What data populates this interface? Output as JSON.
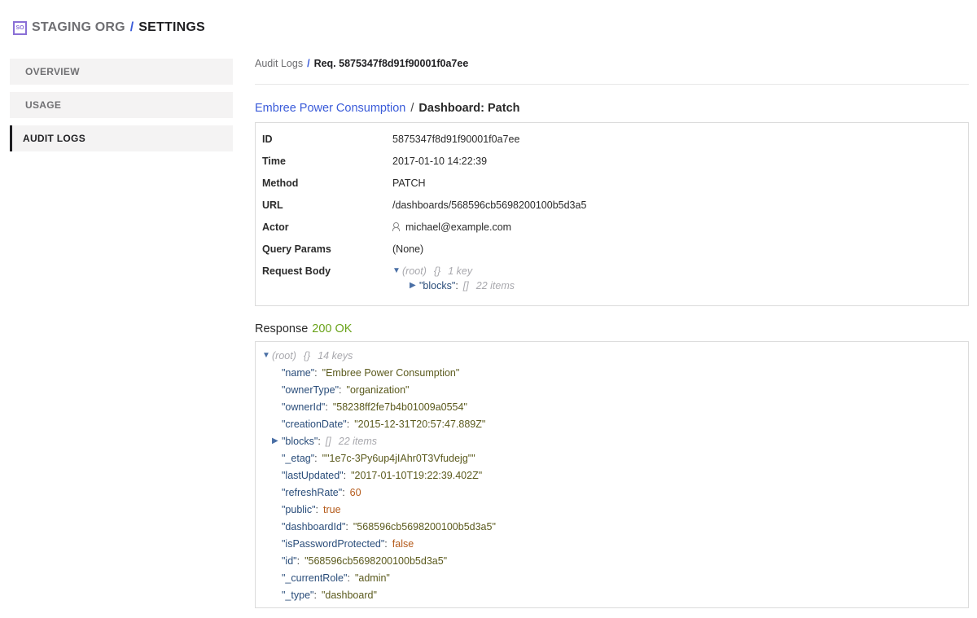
{
  "header": {
    "badge": "SO",
    "org": "STAGING ORG",
    "separator": "/",
    "page": "SETTINGS"
  },
  "sidebar": {
    "items": [
      {
        "label": "OVERVIEW"
      },
      {
        "label": "USAGE"
      },
      {
        "label": "AUDIT LOGS"
      }
    ]
  },
  "breadcrumb": {
    "parent": "Audit Logs",
    "separator": "/",
    "current": "Req. 5875347f8d91f90001f0a7ee"
  },
  "request": {
    "resource": "Embree Power Consumption",
    "separator": "/",
    "action": "Dashboard: Patch",
    "fields": [
      {
        "label": "ID",
        "value": "5875347f8d91f90001f0a7ee"
      },
      {
        "label": "Time",
        "value": "2017-01-10 14:22:39"
      },
      {
        "label": "Method",
        "value": "PATCH"
      },
      {
        "label": "URL",
        "value": "/dashboards/568596cb5698200100b5d3a5"
      },
      {
        "label": "Actor",
        "value": "michael@example.com"
      },
      {
        "label": "Query Params",
        "value": "(None)"
      },
      {
        "label": "Request Body",
        "value": ""
      }
    ],
    "body_tree": {
      "root_label": "(root)",
      "root_type": "{}",
      "root_count": "1 key",
      "children": [
        {
          "key": "\"blocks\"",
          "type": "[]",
          "count": "22 items"
        }
      ]
    }
  },
  "response": {
    "label": "Response",
    "status": "200 OK",
    "tree": {
      "root_label": "(root)",
      "root_type": "{}",
      "root_count": "14 keys",
      "entries": [
        {
          "key": "\"name\"",
          "value": "\"Embree Power Consumption\"",
          "kind": "str"
        },
        {
          "key": "\"ownerType\"",
          "value": "\"organization\"",
          "kind": "str"
        },
        {
          "key": "\"ownerId\"",
          "value": "\"58238ff2fe7b4b01009a0554\"",
          "kind": "str"
        },
        {
          "key": "\"creationDate\"",
          "value": "\"2015-12-31T20:57:47.889Z\"",
          "kind": "str"
        },
        {
          "key": "\"blocks\"",
          "type": "[]",
          "count": "22 items",
          "kind": "collapsed"
        },
        {
          "key": "\"_etag\"",
          "value": "\"\"1e7c-3Py6up4jIAhr0T3Vfudejg\"\"",
          "kind": "str"
        },
        {
          "key": "\"lastUpdated\"",
          "value": "\"2017-01-10T19:22:39.402Z\"",
          "kind": "str"
        },
        {
          "key": "\"refreshRate\"",
          "value": "60",
          "kind": "num"
        },
        {
          "key": "\"public\"",
          "value": "true",
          "kind": "bool"
        },
        {
          "key": "\"dashboardId\"",
          "value": "\"568596cb5698200100b5d3a5\"",
          "kind": "str"
        },
        {
          "key": "\"isPasswordProtected\"",
          "value": "false",
          "kind": "bool"
        },
        {
          "key": "\"id\"",
          "value": "\"568596cb5698200100b5d3a5\"",
          "kind": "str"
        },
        {
          "key": "\"_currentRole\"",
          "value": "\"admin\"",
          "kind": "str"
        },
        {
          "key": "\"_type\"",
          "value": "\"dashboard\"",
          "kind": "str"
        }
      ]
    }
  },
  "colors": {
    "accent": "#3a5bd9",
    "badge": "#8a6fd6",
    "status_ok": "#6aa31a",
    "json_key": "#2a4d7a",
    "json_string": "#5b5a1d",
    "json_number": "#b45a1a"
  },
  "icons": {
    "expanded": "triangle-down-icon",
    "collapsed": "triangle-right-icon",
    "actor": "person-icon"
  }
}
